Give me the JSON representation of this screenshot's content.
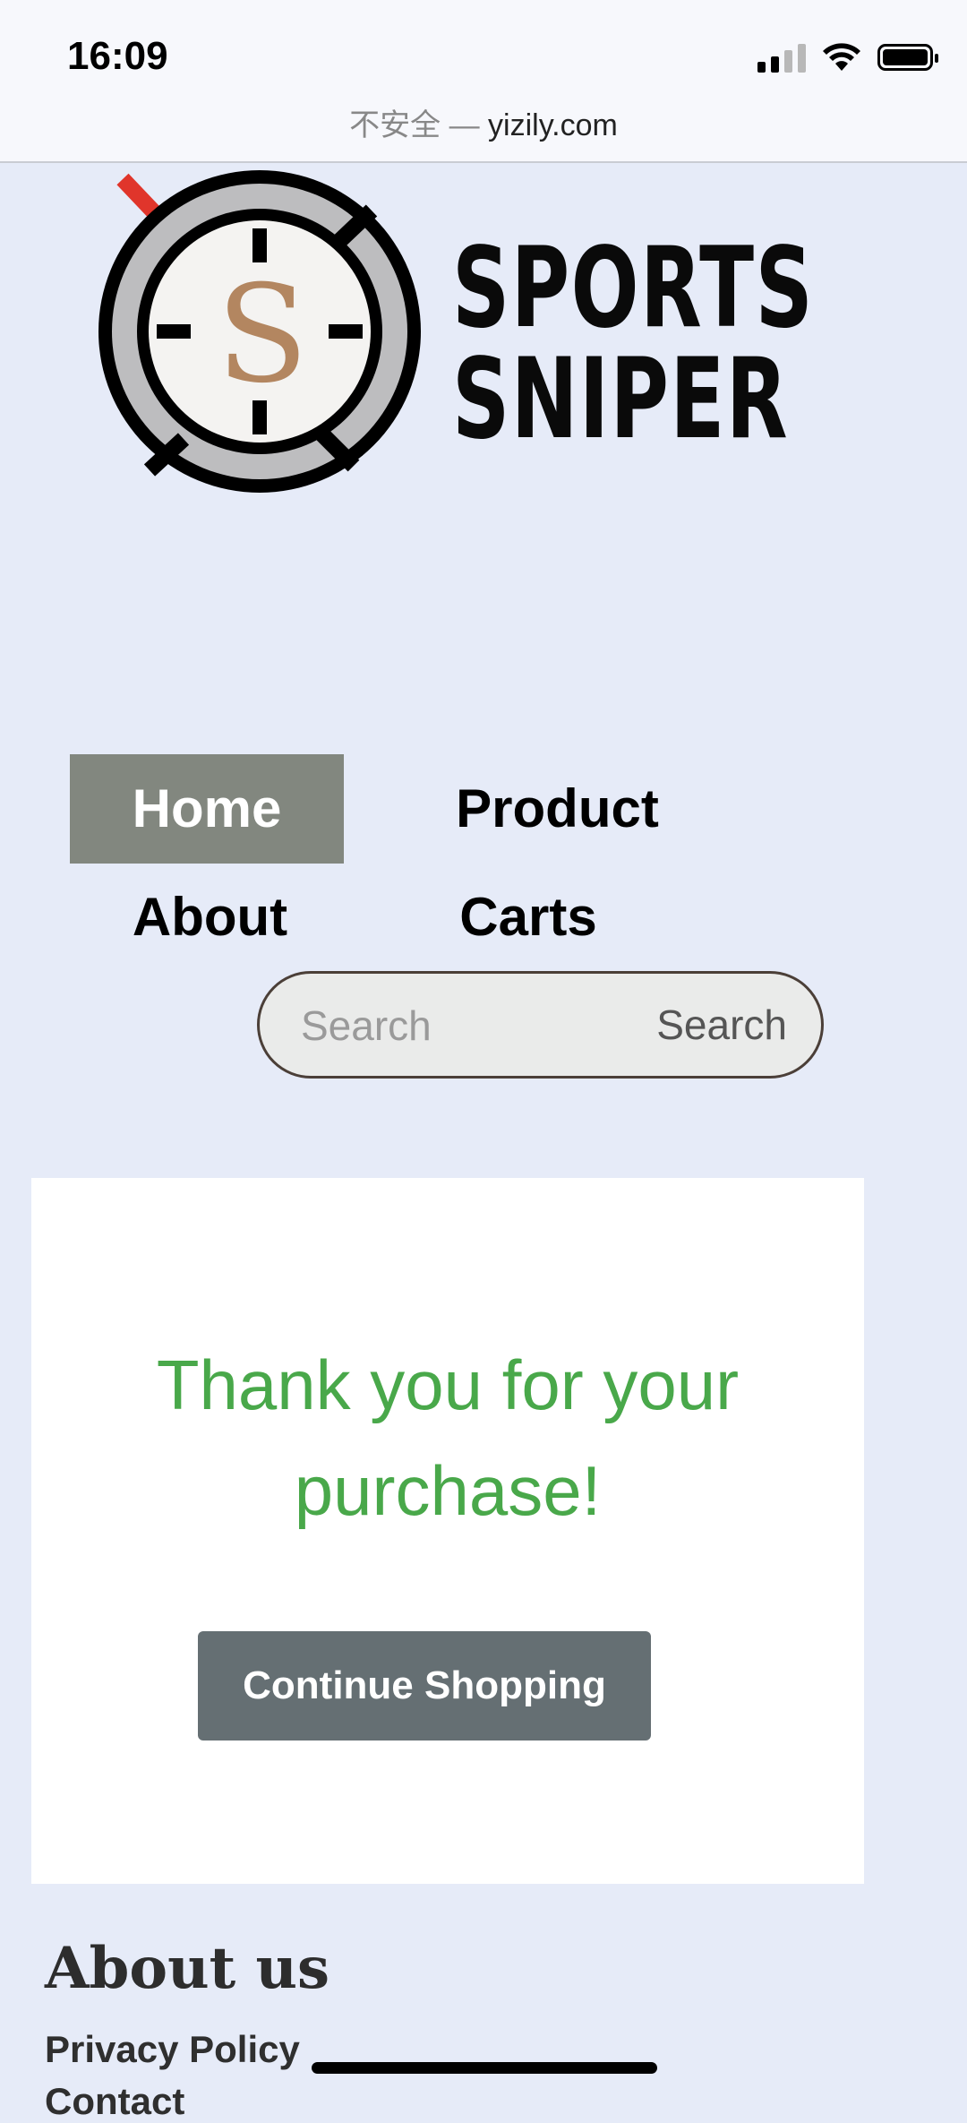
{
  "status": {
    "time": "16:09"
  },
  "browser": {
    "insecure_label": "不安全 —",
    "domain": "yizily.com"
  },
  "logo": {
    "line1": "SPORTS",
    "line2": "SNIPER",
    "emblem_letter": "S"
  },
  "nav": {
    "home": "Home",
    "product": "Product",
    "about": "About",
    "carts": "Carts"
  },
  "search": {
    "placeholder": "Search",
    "button": "Search"
  },
  "confirmation": {
    "line1": "Thank you for your",
    "line2": "purchase!",
    "button": "Continue Shopping"
  },
  "footer": {
    "heading": "About us",
    "privacy": "Privacy Policy",
    "contact": "Contact"
  },
  "colors": {
    "background": "#e6ebf8",
    "nav_active": "#82877f",
    "thanks_text": "#49a84a",
    "cta": "#656f73"
  }
}
